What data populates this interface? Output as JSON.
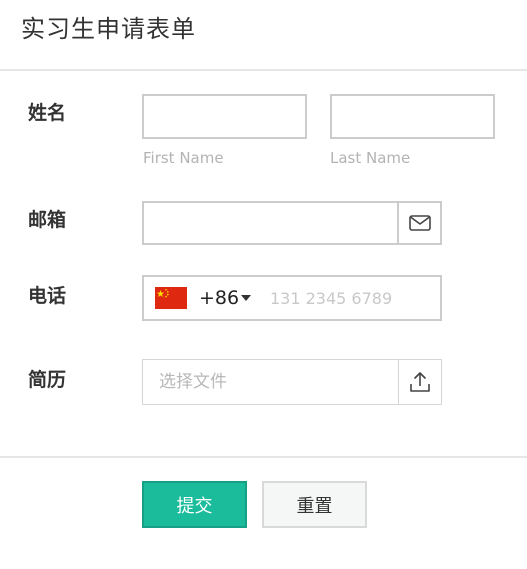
{
  "form": {
    "title": "实习生申请表单"
  },
  "fields": {
    "name": {
      "label": "姓名",
      "first_caption": "First Name",
      "last_caption": "Last Name",
      "first_value": "",
      "last_value": ""
    },
    "email": {
      "label": "邮箱",
      "value": "",
      "icon": "envelope-icon"
    },
    "phone": {
      "label": "电话",
      "country_flag": "china-flag",
      "country_code": "+86",
      "value": "",
      "placeholder": "131 2345 6789"
    },
    "resume": {
      "label": "简历",
      "placeholder": "选择文件",
      "icon": "upload-icon"
    }
  },
  "actions": {
    "submit_label": "提交",
    "reset_label": "重置"
  },
  "colors": {
    "primary": "#1abc9c",
    "flag_red": "#de2910",
    "flag_yellow": "#ffde00"
  }
}
